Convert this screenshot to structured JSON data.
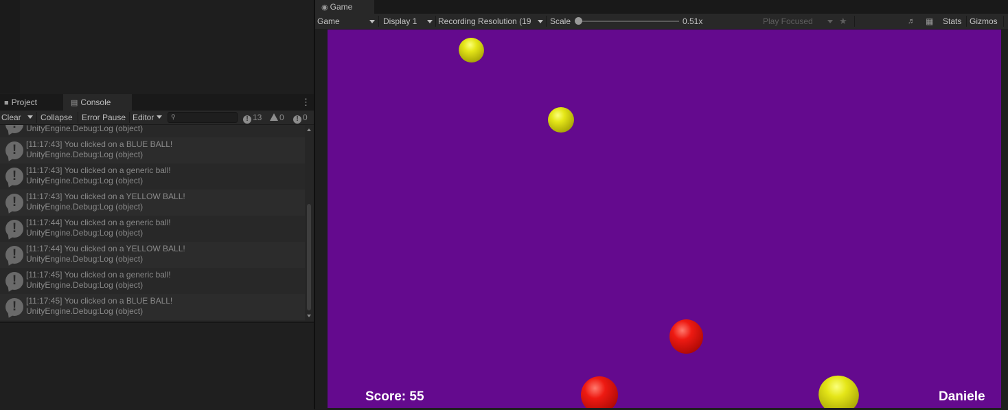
{
  "console": {
    "tabs": [
      {
        "label": "Project",
        "icon": "folder-icon"
      },
      {
        "label": "Console",
        "icon": "console-icon"
      }
    ],
    "toolbar": {
      "clear": "Clear",
      "collapse": "Collapse",
      "error_pause": "Error Pause",
      "editor": "Editor",
      "search_value": ""
    },
    "counts": {
      "log": "13",
      "warning": "0",
      "error": "0"
    },
    "entries": [
      {
        "line1": "",
        "line2": "UnityEngine.Debug:Log (object)"
      },
      {
        "line1": "[11:17:43] You clicked on a BLUE BALL!",
        "line2": "UnityEngine.Debug:Log (object)"
      },
      {
        "line1": "[11:17:43] You clicked on a generic ball!",
        "line2": "UnityEngine.Debug:Log (object)"
      },
      {
        "line1": "[11:17:43] You clicked on a YELLOW BALL!",
        "line2": "UnityEngine.Debug:Log (object)"
      },
      {
        "line1": "[11:17:44] You clicked on a generic ball!",
        "line2": "UnityEngine.Debug:Log (object)"
      },
      {
        "line1": "[11:17:44] You clicked on a YELLOW BALL!",
        "line2": "UnityEngine.Debug:Log (object)"
      },
      {
        "line1": "[11:17:45] You clicked on a generic ball!",
        "line2": "UnityEngine.Debug:Log (object)"
      },
      {
        "line1": "[11:17:45] You clicked on a BLUE BALL!",
        "line2": "UnityEngine.Debug:Log (object)"
      }
    ]
  },
  "game": {
    "tab_label": "Game",
    "toolbar": {
      "view": "Game",
      "display": "Display 1",
      "resolution": "Recording Resolution (19",
      "scale_label": "Scale",
      "scale_value": "0.51x",
      "play_mode": "Play Focused",
      "stats": "Stats",
      "gizmos": "Gizmos"
    },
    "hud": {
      "score": "Score: 55",
      "player": "Daniele"
    },
    "background_color": "#640a8e"
  }
}
